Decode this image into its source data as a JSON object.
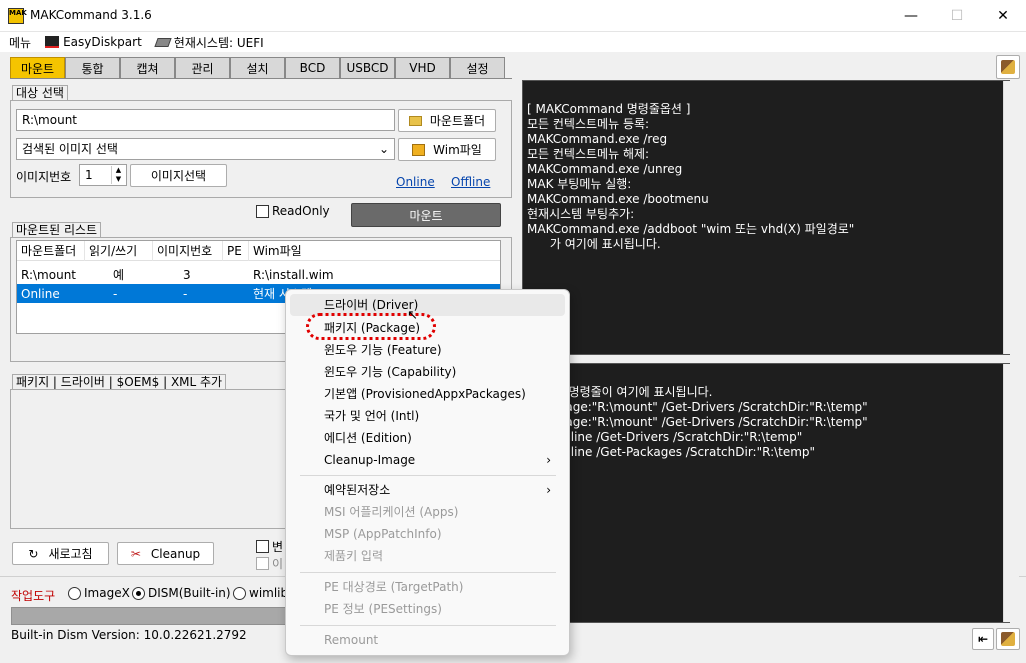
{
  "window": {
    "title": "MAKCommand 3.1.6",
    "minimize": "—",
    "maximize": "☐",
    "close": "✕"
  },
  "menubar": {
    "menu": "메뉴",
    "easydiskpart": "EasyDiskpart",
    "system": "현재시스템: UEFI"
  },
  "tabs": [
    "마운트",
    "통합",
    "캡쳐",
    "관리",
    "설치",
    "BCD",
    "USBCD",
    "VHD",
    "설정"
  ],
  "target": {
    "group_label": "대상 선택",
    "mount_path": "R:\\mount",
    "mount_folder_btn": "마운트폴더",
    "image_select": "검색된 이미지 선택",
    "wim_btn": "Wim파일",
    "image_no_label": "이미지번호",
    "image_no": "1",
    "image_select_btn": "이미지선택",
    "online": "Online",
    "offline": "Offline",
    "readonly": "ReadOnly",
    "mount_btn": "마운트"
  },
  "mounted": {
    "group_label": "마운트된 리스트",
    "columns": [
      "마운트폴더",
      "읽기/쓰기",
      "이미지번호",
      "PE",
      "Wim파일"
    ],
    "rows": [
      [
        "R:\\mount",
        "예",
        "3",
        "",
        "R:\\install.wim"
      ],
      [
        "Online",
        "-",
        "-",
        "",
        "현재 시스템"
      ]
    ]
  },
  "package_group": {
    "label": "패키지 | 드라이버 | $OEM$ | XML 추가"
  },
  "bottom": {
    "refresh_btn": "새로고침",
    "cleanup_btn": "Cleanup",
    "chk1": "변",
    "chk2": "이",
    "tool_label": "작업도구",
    "imagex": "ImageX",
    "dism": "DISM(Built-in)",
    "wimlib": "wimlib",
    "version": "Built-in Dism Version: 10.0.22621.2792"
  },
  "right_top": {
    "lines": [
      "[ MAKCommand 명령줄옵션 ]",
      "",
      "모든 컨텍스트메뉴 등록:",
      "MAKCommand.exe /reg",
      "",
      "모든 컨텍스트메뉴 해제:",
      "MAKCommand.exe /unreg",
      "",
      "MAK 부팅메뉴 실행:",
      "MAKCommand.exe /bootmenu",
      "",
      "현재시스템 부팅추가:",
      "MAKCommand.exe /addboot \"wim 또는 vhd(X) 파일경로\"",
      "",
      "      가 여기에 표시됩니다."
    ]
  },
  "right_bottom": {
    "lines": [
      "       는 명령줄이 여기에 표시됩니다.",
      "",
      "       mage:\"R:\\mount\" /Get-Drivers /ScratchDir:\"R:\\temp\"",
      "",
      "       mage:\"R:\\mount\" /Get-Drivers /ScratchDir:\"R:\\temp\"",
      "",
      "       Online /Get-Drivers /ScratchDir:\"R:\\temp\"",
      "",
      "       Online /Get-Packages /ScratchDir:\"R:\\temp\""
    ]
  },
  "context_menu": {
    "items": [
      {
        "label": "드라이버 (Driver)",
        "disabled": false
      },
      {
        "label": "패키지 (Package)",
        "disabled": false
      },
      {
        "label": "윈도우 기능 (Feature)",
        "disabled": false
      },
      {
        "label": "윈도우 기능 (Capability)",
        "disabled": false
      },
      {
        "label": "기본앱 (ProvisionedAppxPackages)",
        "disabled": false
      },
      {
        "label": "국가 및 언어 (Intl)",
        "disabled": false
      },
      {
        "label": "에디션 (Edition)",
        "disabled": false
      },
      {
        "label": "Cleanup-Image",
        "disabled": false,
        "submenu": "›"
      },
      {
        "label": "예약된저장소",
        "disabled": false,
        "submenu": "›"
      },
      {
        "label": "MSI 어플리케이션 (Apps)",
        "disabled": true
      },
      {
        "label": "MSP (AppPatchInfo)",
        "disabled": true
      },
      {
        "label": "제품키 입력",
        "disabled": true
      },
      {
        "label": "PE 대상경로 (TargetPath)",
        "disabled": true
      },
      {
        "label": "PE 정보 (PESettings)",
        "disabled": true
      },
      {
        "label": "Remount",
        "disabled": true
      }
    ]
  },
  "colors": {
    "accent_tab": "#f5c400",
    "selection": "#0078d7",
    "highlight_ring": "#e00000",
    "console_bg": "#1e1e1e"
  }
}
